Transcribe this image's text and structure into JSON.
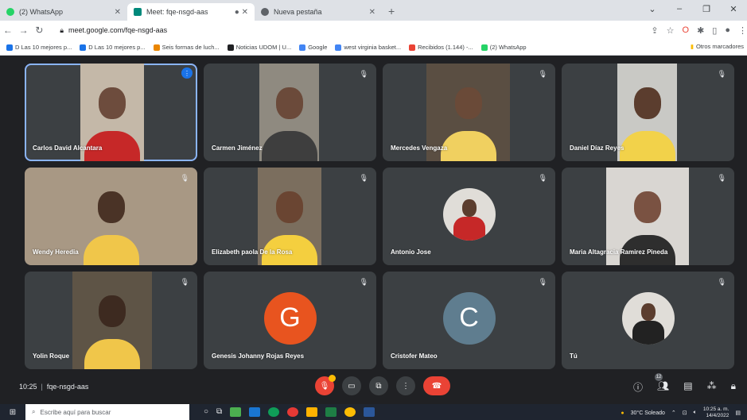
{
  "browser": {
    "tabs": [
      {
        "label": "(2) WhatsApp",
        "icon": "whatsapp-icon",
        "color": "#25d366",
        "active": false
      },
      {
        "label": "Meet: fqe-nsgd-aas",
        "icon": "meet-icon",
        "color": "#00897b",
        "active": true
      },
      {
        "label": "Nueva pestaña",
        "icon": "chrome-icon",
        "color": "#5f6368",
        "active": false
      }
    ],
    "url": "meet.google.com/fqe-nsgd-aas",
    "bookmarks": [
      {
        "label": "D Las 10 mejores p...",
        "color": "#1a73e8"
      },
      {
        "label": "D Las 10 mejores p...",
        "color": "#1a73e8"
      },
      {
        "label": "Seis formas de luch...",
        "color": "#ea8600"
      },
      {
        "label": "Noticias UDOM | U...",
        "color": "#202124"
      },
      {
        "label": "Google",
        "color": "#4285f4"
      },
      {
        "label": "west virginia basket...",
        "color": "#4285f4"
      },
      {
        "label": "Recibidos (1.144) -...",
        "color": "#ea4335"
      },
      {
        "label": "(2) WhatsApp",
        "color": "#25d366"
      }
    ],
    "other_bookmarks": "Otros marcadores"
  },
  "participants": [
    {
      "name": "Carlos David Alcantara",
      "type": "video",
      "speaking": true,
      "bg": "#c4b8a8"
    },
    {
      "name": "Carmen Jiménez",
      "type": "video",
      "speaking": false,
      "bg": "#8f8a80"
    },
    {
      "name": "Mercedes Vengaza",
      "type": "video",
      "speaking": false,
      "bg": "#5a4e42"
    },
    {
      "name": "Daniel Díaz Reyes",
      "type": "video",
      "speaking": false,
      "bg": "#c9c9c5"
    },
    {
      "name": "Wendy Heredia",
      "type": "video",
      "speaking": false,
      "bg": "#a89884"
    },
    {
      "name": "Elizabeth paola De la Rosa",
      "type": "video",
      "speaking": false,
      "bg": "#7b6e5e"
    },
    {
      "name": "Antonio Jose",
      "type": "avatar-photo",
      "speaking": false,
      "bg": "#3c4043"
    },
    {
      "name": "Maria Altagracia Ramirez Pineda",
      "type": "video",
      "speaking": false,
      "bg": "#d9d6d2"
    },
    {
      "name": "Yolin Roque",
      "type": "video",
      "speaking": false,
      "bg": "#5e5446"
    },
    {
      "name": "Genesis Johanny Rojas Reyes",
      "type": "avatar-letter",
      "letter": "G",
      "avatar_color": "#e8541f",
      "speaking": false
    },
    {
      "name": "Cristofer Mateo",
      "type": "avatar-letter",
      "letter": "C",
      "avatar_color": "#5f7d8f",
      "speaking": false
    },
    {
      "name": "Tú",
      "type": "avatar-photo",
      "speaking": false,
      "bg": "#3c4043"
    }
  ],
  "controls": {
    "time": "10:25",
    "separator": "|",
    "meeting_code": "fqe-nsgd-aas",
    "people_count": "12"
  },
  "taskbar": {
    "search_placeholder": "Escribe aquí para buscar",
    "weather": "30°C Soleado",
    "time": "10:25 a. m.",
    "date": "14/4/2022"
  }
}
